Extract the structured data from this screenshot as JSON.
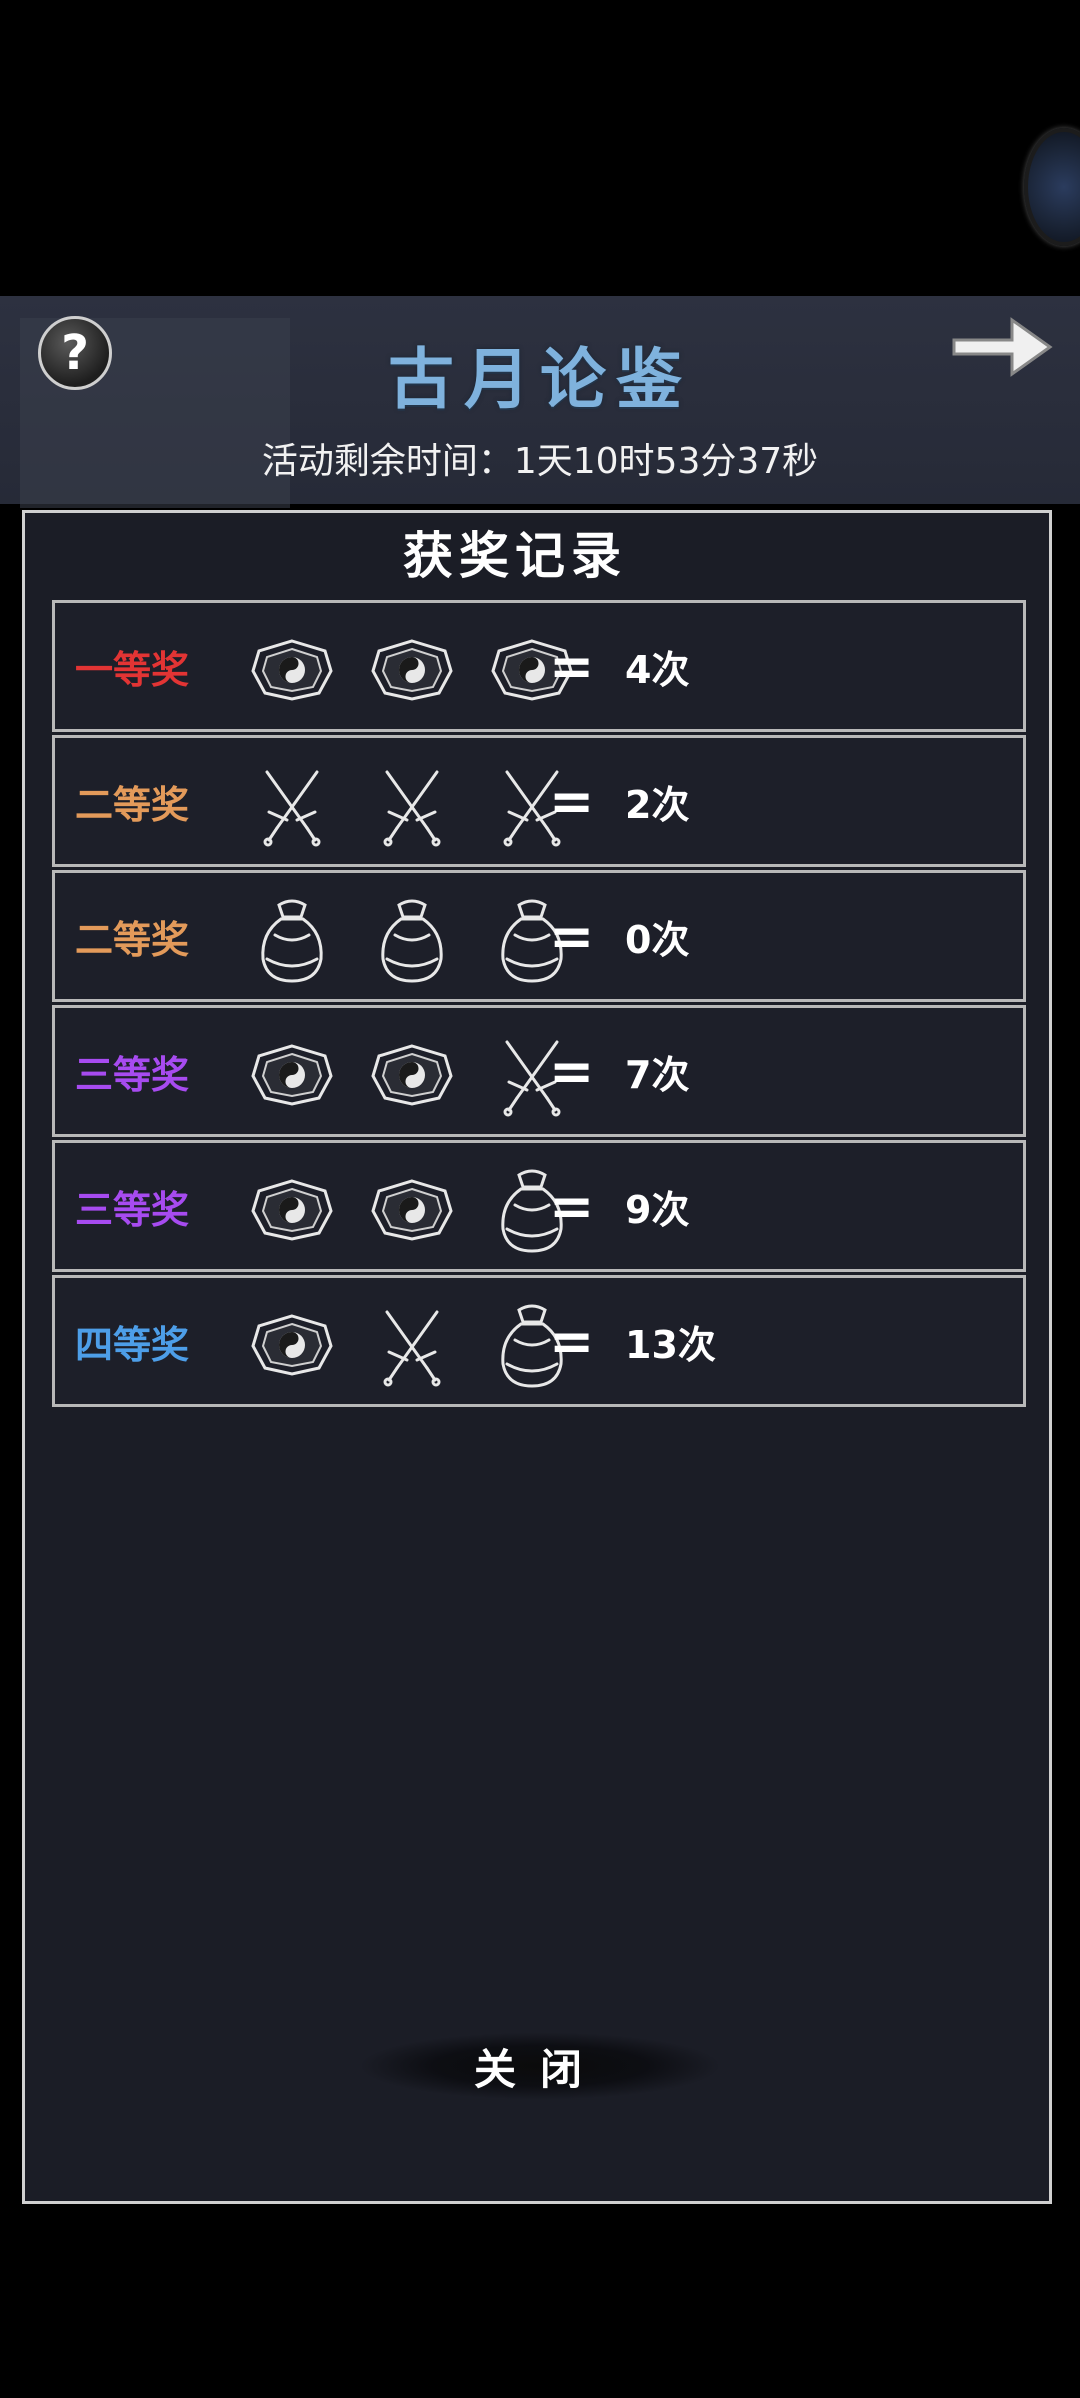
{
  "header": {
    "title": "古月论鉴",
    "timer": "活动剩余时间：1天10时53分37秒"
  },
  "panel": {
    "title": "获奖记录",
    "equals": "=",
    "rows": [
      {
        "label": "一等奖",
        "color": "#e23434",
        "icons": [
          "bagua-icon",
          "bagua-icon",
          "bagua-icon"
        ],
        "count": "4次"
      },
      {
        "label": "二等奖",
        "color": "#e39a5a",
        "icons": [
          "crossed-swords-icon",
          "crossed-swords-icon",
          "crossed-swords-icon"
        ],
        "count": "2次"
      },
      {
        "label": "二等奖",
        "color": "#e39a5a",
        "icons": [
          "pouch-icon",
          "pouch-icon",
          "pouch-icon"
        ],
        "count": "0次"
      },
      {
        "label": "三等奖",
        "color": "#a74bf0",
        "icons": [
          "bagua-icon",
          "bagua-icon",
          "crossed-swords-icon"
        ],
        "count": "7次"
      },
      {
        "label": "三等奖",
        "color": "#a74bf0",
        "icons": [
          "bagua-icon",
          "bagua-icon",
          "pouch-icon"
        ],
        "count": "9次"
      },
      {
        "label": "四等奖",
        "color": "#4d9ee8",
        "icons": [
          "bagua-icon",
          "crossed-swords-icon",
          "pouch-icon"
        ],
        "count": "13次"
      }
    ],
    "close_label": "关闭"
  }
}
